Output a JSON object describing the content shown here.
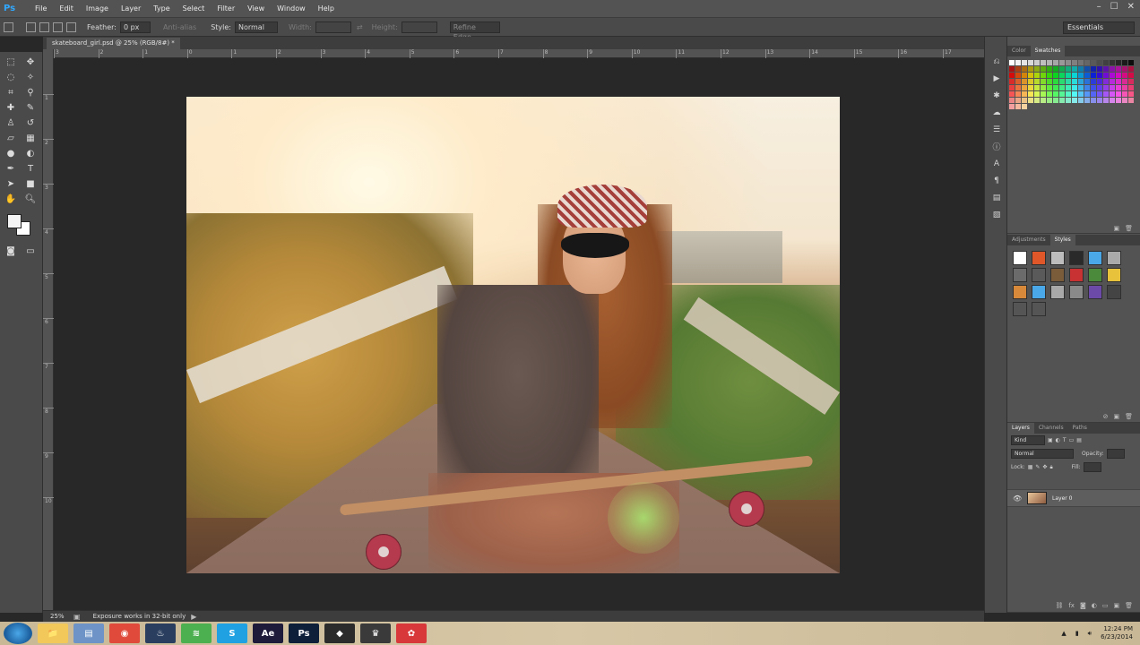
{
  "menu": {
    "logo": "Ps",
    "items": [
      "File",
      "Edit",
      "Image",
      "Layer",
      "Type",
      "Select",
      "Filter",
      "View",
      "Window",
      "Help"
    ],
    "window_controls": [
      "–",
      "☐",
      "✕"
    ]
  },
  "options_bar": {
    "feather_label": "Feather:",
    "feather_value": "0 px",
    "anti_alias_label": "Anti-alias",
    "style_label": "Style:",
    "style_value": "Normal",
    "width_label": "Width:",
    "height_label": "Height:",
    "refine_edge_label": "Refine Edge...",
    "workspace": "Essentials"
  },
  "document": {
    "tab_title": "skateboard_girl.psd @ 25% (RGB/8#) *",
    "zoom": "25%",
    "status": "Exposure works in 32-bit only"
  },
  "rulers": {
    "top": [
      "3",
      "2",
      "1",
      "0",
      "1",
      "2",
      "3",
      "4",
      "5",
      "6",
      "7",
      "8",
      "9",
      "10",
      "11",
      "12",
      "13",
      "14",
      "15",
      "16",
      "17"
    ],
    "left": [
      "1",
      "2",
      "3",
      "4",
      "5",
      "6",
      "7",
      "8",
      "9",
      "10"
    ]
  },
  "panels": {
    "swatches": {
      "tabs": [
        "Color",
        "Swatches"
      ],
      "active": "Swatches"
    },
    "styles": {
      "tabs": [
        "Adjustments",
        "Styles"
      ],
      "active": "Styles"
    },
    "layers": {
      "tabs": [
        "Layers",
        "Channels",
        "Paths"
      ],
      "active": "Layers",
      "kind_label": "Kind",
      "blend_mode": "Normal",
      "opacity_label": "Opacity:",
      "lock_label": "Lock:",
      "fill_label": "Fill:",
      "layer_name": "Layer 0"
    }
  },
  "taskbar": {
    "time": "12:24 PM",
    "date": "6/23/2014",
    "apps": [
      {
        "name": "explorer",
        "label": "📁",
        "color": "#f2c85b"
      },
      {
        "name": "notepad",
        "label": "▤",
        "color": "#6e93c7"
      },
      {
        "name": "chrome",
        "label": "◉",
        "color": "#e04a3a"
      },
      {
        "name": "steam",
        "label": "♨",
        "color": "#2a3f5f"
      },
      {
        "name": "spotify",
        "label": "≋",
        "color": "#4caf50"
      },
      {
        "name": "skype",
        "label": "S",
        "color": "#1fa1e2"
      },
      {
        "name": "after-effects",
        "label": "Ae",
        "color": "#1e1a3a"
      },
      {
        "name": "photoshop",
        "label": "Ps",
        "color": "#0e1f3a"
      },
      {
        "name": "app-dark",
        "label": "◆",
        "color": "#2b2b2b"
      },
      {
        "name": "app-game",
        "label": "♛",
        "color": "#3a3a3a"
      },
      {
        "name": "app-red",
        "label": "✿",
        "color": "#d8383a"
      }
    ]
  },
  "colors": {
    "accent": "#31a8ff",
    "foreground": "#f4f4f4",
    "background": "#ffffff"
  }
}
